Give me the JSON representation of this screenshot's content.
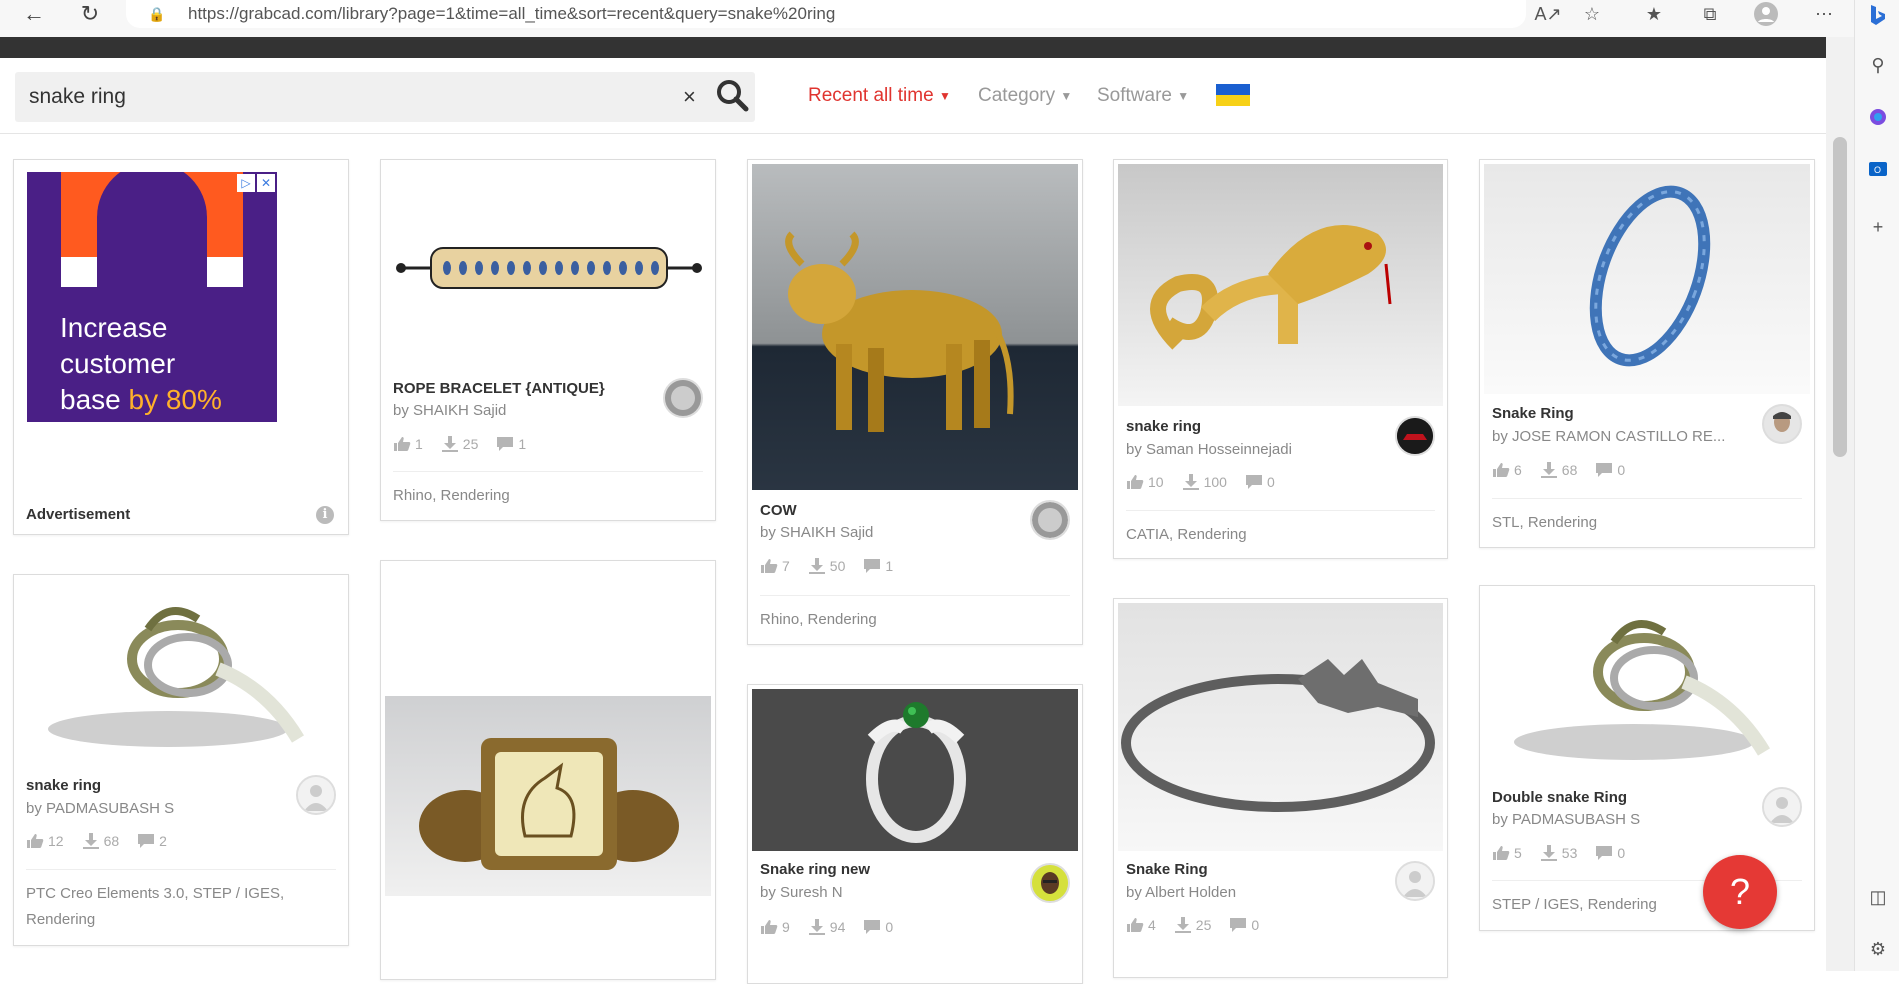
{
  "browser": {
    "url": "https://grabcad.com/library?page=1&time=all_time&sort=recent&query=snake%20ring"
  },
  "search": {
    "value": "snake ring",
    "clear_glyph": "×"
  },
  "filters": {
    "time": "Recent all time",
    "category": "Category",
    "software": "Software"
  },
  "ad": {
    "line1": "Increase",
    "line2": "customer",
    "line3_prefix": "base",
    "line3_highlight": "by 80%",
    "label": "Advertisement",
    "info_glyph": "i",
    "brand_color": "#4a1f86",
    "accent_color": "#ff5a1f"
  },
  "cards": [
    {
      "title": "ROPE BRACELET {ANTIQUE}",
      "author": "by SHAIKH Sajid",
      "likes": "1",
      "downloads": "25",
      "comments": "1",
      "tags": "Rhino, Rendering"
    },
    {
      "title": "COW",
      "author": "by SHAIKH Sajid",
      "likes": "7",
      "downloads": "50",
      "comments": "1",
      "tags": "Rhino, Rendering"
    },
    {
      "title": "snake ring",
      "author": "by Saman Hosseinnejadi",
      "likes": "10",
      "downloads": "100",
      "comments": "0",
      "tags": "CATIA, Rendering"
    },
    {
      "title": "Snake Ring",
      "author": "by JOSE RAMON CASTILLO RE...",
      "likes": "6",
      "downloads": "68",
      "comments": "0",
      "tags": "STL, Rendering"
    },
    {
      "title": "snake ring",
      "author": "by PADMASUBASH S",
      "likes": "12",
      "downloads": "68",
      "comments": "2",
      "tags": "PTC Creo Elements 3.0, STEP / IGES, Rendering"
    },
    {
      "title": "Snake ring new",
      "author": "by Suresh N",
      "likes": "9",
      "downloads": "94",
      "comments": "0",
      "tags": ""
    },
    {
      "title": "Snake Ring",
      "author": "by Albert Holden",
      "likes": "4",
      "downloads": "25",
      "comments": "0",
      "tags": ""
    },
    {
      "title": "Double snake Ring",
      "author": "by PADMASUBASH S",
      "likes": "5",
      "downloads": "53",
      "comments": "0",
      "tags": "STEP / IGES, Rendering"
    }
  ],
  "help": {
    "glyph": "?"
  },
  "colors": {
    "accent": "#e0342f",
    "help": "#e53935"
  }
}
